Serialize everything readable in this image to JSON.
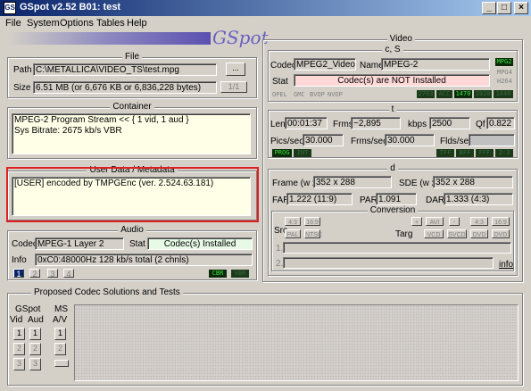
{
  "window": {
    "title": "GSpot v2.52 B01: test",
    "app_icon": "GS",
    "min": "_",
    "max": "□",
    "close": "×"
  },
  "menu": [
    "File",
    "System",
    "Options",
    "Tables",
    "Help"
  ],
  "logo": {
    "text": "GSpot"
  },
  "file": {
    "title": "File",
    "path_label": "Path",
    "path": "C:\\METALLICA\\VIDEO_TS\\test.mpg",
    "browse": "...",
    "size_label": "Size",
    "size": "6.51 MB (or 6,676 KB or 6,836,228 bytes)",
    "page": "1/1"
  },
  "container": {
    "title": "Container",
    "line1": "MPEG-2 Program Stream << { 1 vid, 1 aud }",
    "line2": "Sys Bitrate: 2675 kb/s VBR"
  },
  "userdata": {
    "title": "User Data / Metadata",
    "text": "[USER]    encoded by TMPGEnc (ver. 2.524.63.181)"
  },
  "audio": {
    "title": "Audio",
    "codec_label": "Codec",
    "codec": "MPEG-1 Layer 2",
    "stat_label": "Stat",
    "stat": "Codec(s) Installed",
    "info_label": "Info",
    "info": "0xC0:48000Hz  128 kb/s total (2 chnls)",
    "tabs": [
      "1",
      "2",
      "3",
      "4"
    ],
    "leds": [
      "CBR",
      "VBR"
    ]
  },
  "video": {
    "title": "Video",
    "cs_title": "c, S",
    "codec_label": "Codec",
    "codec": "MPEG2_Video",
    "name_label": "Name",
    "name": "MPEG-2",
    "stat_label": "Stat",
    "stat": "Codec(s) are NOT Installed",
    "side_leds": [
      "MPG2",
      "MPG4",
      "H264",
      "H264"
    ],
    "small_flags": [
      "OPEL",
      "GMC",
      "BVOP",
      "NVOP"
    ],
    "small_leds": [
      "2703",
      "ACC",
      "1470",
      "1920",
      "1440"
    ]
  },
  "timing": {
    "title": "t",
    "len_label": "Len",
    "len": "00:01:37",
    "frms_label": "Frms",
    "frms": "~2,895",
    "kbps_label": "kbps",
    "kbps": "2500",
    "qf_label": "Qf",
    "qf": "0.822",
    "pics_label": "Pics/sec",
    "pics": "30.000",
    "frmsec_label": "Frms/sec",
    "frmsec": "30.000",
    "flds_label": "Flds/sec",
    "flds": "",
    "leds_left": [
      "PROG",
      "INT"
    ],
    "leds_right": [
      "TFF",
      "BFF",
      "FFF",
      "2:3"
    ]
  },
  "dims": {
    "title": "d",
    "frame_label": "Frame (w x",
    "frame": "352 x 288",
    "sde_label": "SDE (w x",
    "sde": "352 x 288",
    "far_label": "FAR",
    "far": "1.222 (11:9)",
    "par_label": "PAR",
    "par": "1.091",
    "dar_label": "DAR",
    "dar": "1.333 (4:3)"
  },
  "conversion": {
    "title": "Conversion",
    "src_label": "Src",
    "targ_label": "Targ",
    "src_btns": [
      "4:3",
      "16:9",
      "PAL",
      "NTSC"
    ],
    "top_btns": [
      "+",
      "AVI",
      "-",
      "4:3",
      "16:9"
    ],
    "targ_btns": [
      "VCD",
      "SVCD",
      "DVD",
      "DVD"
    ],
    "row1": "1.",
    "row2": "2.",
    "info": "info"
  },
  "proposed": {
    "title": "Proposed Codec Solutions and Tests",
    "gspot_label": "GSpot",
    "vid_label": "Vid",
    "aud_label": "Aud",
    "ms_label": "MS",
    "av_label": "A/V",
    "vid": [
      "1",
      "2",
      "3"
    ],
    "aud": [
      "1",
      "2",
      "3"
    ],
    "ms": [
      "1",
      "2"
    ]
  }
}
